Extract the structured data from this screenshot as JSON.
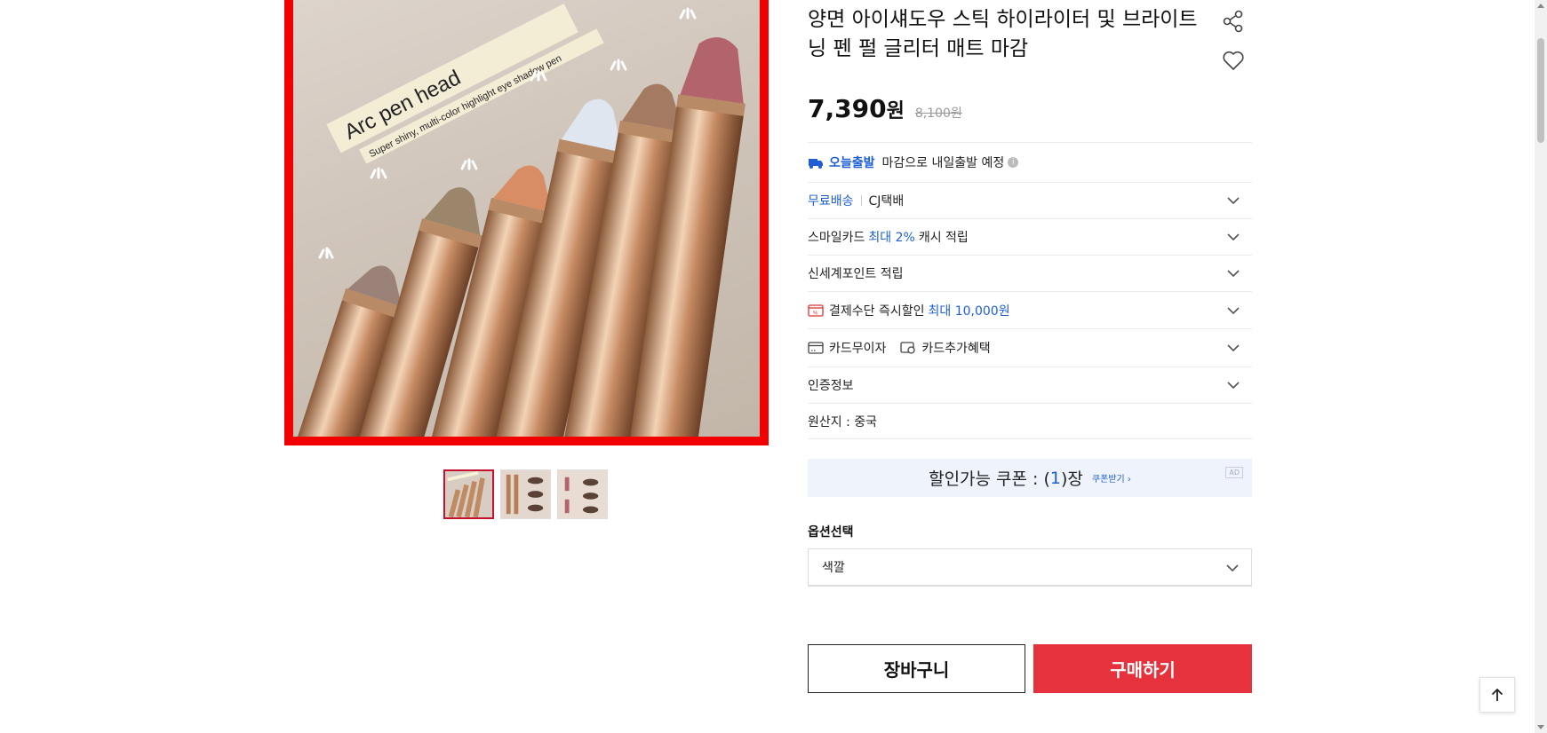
{
  "product": {
    "image_caption_line1": "Arc pen head",
    "image_caption_line2": "Super shiny, multi-color highlight eye shadow pen",
    "title": "양면 아이섀도우 스틱 하이라이터 및 브라이트닝 펜 펄 글리터 매트 마감",
    "price": "7,390",
    "price_unit": "원",
    "original_price": "8,100원",
    "thumbnail_count": 3
  },
  "delivery": {
    "today_label": "오늘출발",
    "today_note": "마감으로 내일출발 예정"
  },
  "rows": {
    "free_shipping": "무료배송",
    "courier": "CJ택배",
    "smile_card_prefix": "스마일카드",
    "smile_card_highlight": "최대 2%",
    "smile_card_suffix": "캐시 적립",
    "shinsegae_points": "신세계포인트 적립",
    "payment_discount_prefix": "결제수단 즉시할인",
    "payment_discount_highlight": "최대 10,000원",
    "installment": "카드무이자",
    "card_benefit": "카드추가혜택",
    "certification": "인증정보",
    "origin": "원산지 : 중국"
  },
  "coupon": {
    "prefix": "할인가능 쿠폰 : (",
    "count": "1",
    "suffix": ")장",
    "get_link": "쿠폰받기 ›",
    "ad": "AD"
  },
  "options": {
    "label": "옵션선택",
    "selected": "색깔"
  },
  "actions": {
    "cart": "장바구니",
    "buy": "구매하기"
  },
  "colors": {
    "accent_red": "#e5323c",
    "frame_red": "#f20000",
    "link_blue": "#1e5fd6"
  }
}
